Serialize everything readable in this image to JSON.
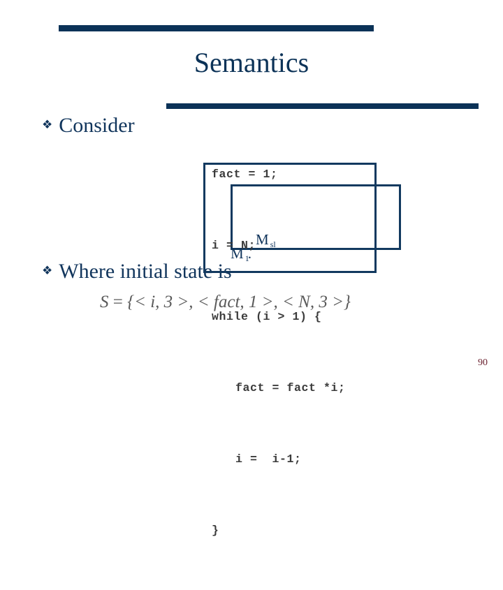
{
  "slide": {
    "title": "Semantics",
    "page_number": "90",
    "accent_color": "#0b3257",
    "text_color": "#11355c",
    "code_color": "#3b3b3b",
    "formula_color": "#5a5a5a",
    "page_number_color": "#6b2230",
    "background_color": "#ffffff"
  },
  "bullets": [
    {
      "glyph": "❖",
      "text": "Consider"
    },
    {
      "glyph": "❖",
      "text": "Where initial state is"
    }
  ],
  "code": {
    "lines": [
      {
        "text": "fact = 1;",
        "indent": false
      },
      {
        "text": "i = N;",
        "indent": false
      },
      {
        "text": "while (i > 1) {",
        "indent": false
      },
      {
        "text": "fact = fact *i;",
        "indent": true
      },
      {
        "text": "i =  i-1;",
        "indent": true
      },
      {
        "text": "}",
        "indent": false
      }
    ]
  },
  "annotations": [
    {
      "name": "outer-while-box",
      "label_base": "M",
      "label_sub": "1",
      "label_suffix": "."
    },
    {
      "name": "inner-body-box",
      "label_base": "M",
      "label_sub": "sl",
      "label_suffix": ""
    }
  ],
  "labels": {
    "m_sl_base": "M",
    "m_sl_sub": "sl",
    "m_1_base": "M",
    "m_1_sub": "1",
    "m_1_suffix": "."
  },
  "formula": {
    "lhs": "S",
    "eq": " = ",
    "body": "{< i, 3 >, < fact, 1 >, < N, 3 >}",
    "full": "S = {< i, 3 >, < fact, 1 >, < N, 3 >}"
  }
}
